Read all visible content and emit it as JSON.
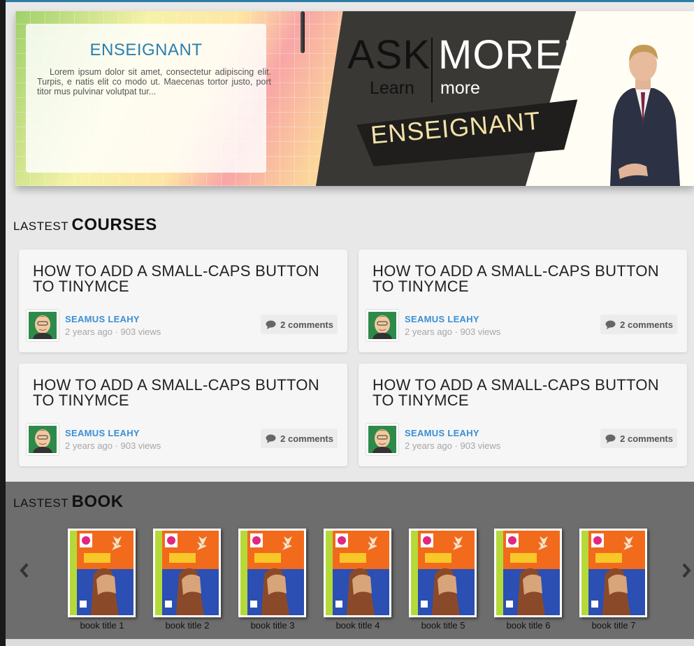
{
  "banner": {
    "card_title": "ENSEIGNANT",
    "card_description": "Lorem ipsum dolor sit amet, consectetur adipiscing elit. Turpis, e natis elit co modo ut. Maecenas tortor justo, port titor mus pulvinar volutpat tur...",
    "ask": "ASK",
    "more": "MORE!",
    "learn": "Learn",
    "more_small": "more",
    "ribbon": "ENSEIGNANT"
  },
  "courses_section": {
    "prefix": "LASTEST",
    "title": "COURSES"
  },
  "courses": [
    {
      "title": "HOW TO ADD A SMALL-CAPS BUTTON TO TINYMCE",
      "author": "SEAMUS LEAHY",
      "meta": "2 years ago · 903 views",
      "comments": "2 comments"
    },
    {
      "title": "HOW TO ADD A SMALL-CAPS BUTTON TO TINYMCE",
      "author": "SEAMUS LEAHY",
      "meta": "2 years ago · 903 views",
      "comments": "2 comments"
    },
    {
      "title": "HOW TO ADD A SMALL-CAPS BUTTON TO TINYMCE",
      "author": "SEAMUS LEAHY",
      "meta": "2 years ago · 903 views",
      "comments": "2 comments"
    },
    {
      "title": "HOW TO ADD A SMALL-CAPS BUTTON TO TINYMCE",
      "author": "SEAMUS LEAHY",
      "meta": "2 years ago · 903 views",
      "comments": "2 comments"
    }
  ],
  "books_section": {
    "prefix": "LASTEST",
    "title": "BOOK"
  },
  "books": [
    {
      "title": "book title 1"
    },
    {
      "title": "book title 2"
    },
    {
      "title": "book title 3"
    },
    {
      "title": "book title 4"
    },
    {
      "title": "book title 5"
    },
    {
      "title": "book title 6"
    },
    {
      "title": "book title 7"
    }
  ],
  "icons": {
    "prev": "chevron-left-icon",
    "next": "chevron-right-icon",
    "comment": "speech-bubble-icon"
  },
  "colors": {
    "accent_blue": "#2a7fb0",
    "author_blue": "#3a8fd4",
    "banner_dark": "#3a3835",
    "ribbon_text": "#f3e2a8",
    "books_band": "#6d6d6d"
  }
}
